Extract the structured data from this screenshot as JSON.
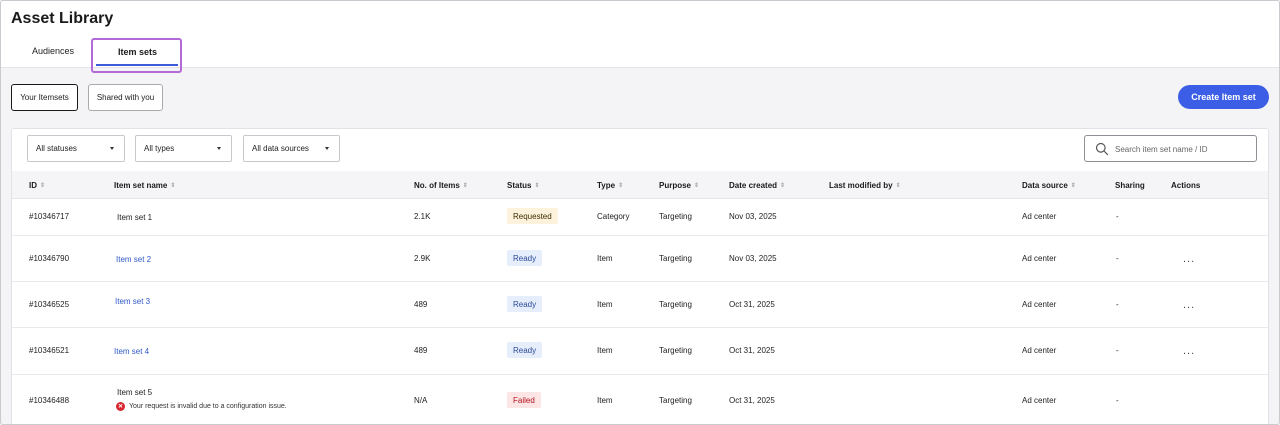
{
  "app": {
    "title": "Asset Library"
  },
  "tabs": [
    {
      "label": "Audiences"
    },
    {
      "label": "Item sets"
    }
  ],
  "segments": [
    {
      "label": "Your Itemsets"
    },
    {
      "label": "Shared with you"
    }
  ],
  "create_button": "Create Item set",
  "filters": [
    {
      "label": "All statuses"
    },
    {
      "label": "All types"
    },
    {
      "label": "All data sources"
    }
  ],
  "search": {
    "placeholder": "Search item set name / ID"
  },
  "columns": {
    "id": "ID",
    "name": "Item set name",
    "items": "No. of Items",
    "status": "Status",
    "type": "Type",
    "purpose": "Purpose",
    "created": "Date created",
    "modified": "Last modified by",
    "source": "Data source",
    "sharing": "Sharing",
    "actions": "Actions"
  },
  "rows": [
    {
      "id": "#10346717",
      "name": "Item set 1",
      "items": "2.1K",
      "status": "Requested",
      "type": "Category",
      "purpose": "Targeting",
      "created": "Nov 03, 2025",
      "source": "Ad center",
      "sharing": "-",
      "actions": ""
    },
    {
      "id": "#10346790",
      "name": "Item set 2",
      "items": "2.9K",
      "status": "Ready",
      "type": "Item",
      "purpose": "Targeting",
      "created": "Nov 03, 2025",
      "source": "Ad center",
      "sharing": "-",
      "actions": "..."
    },
    {
      "id": "#10346525",
      "name": "Item set 3",
      "items": "489",
      "status": "Ready",
      "type": "Item",
      "purpose": "Targeting",
      "created": "Oct 31, 2025",
      "source": "Ad center",
      "sharing": "-",
      "actions": "..."
    },
    {
      "id": "#10346521",
      "name": "Item set 4",
      "items": "489",
      "status": "Ready",
      "type": "Item",
      "purpose": "Targeting",
      "created": "Oct 31, 2025",
      "source": "Ad center",
      "sharing": "-",
      "actions": "..."
    },
    {
      "id": "#10346488",
      "name": "Item set 5",
      "error": "Your request is invalid due to a configuration issue.",
      "items": "N/A",
      "status": "Failed",
      "type": "Item",
      "purpose": "Targeting",
      "created": "Oct 31, 2025",
      "source": "Ad center",
      "sharing": "-",
      "actions": ""
    }
  ],
  "colors": {
    "accent": "#3c5ee6",
    "tab_highlight": "#b36ad9",
    "link": "#2e58c7",
    "requested_bg": "#fdf3dc",
    "ready_bg": "#e7eefb",
    "failed_bg": "#fde5e6",
    "failed_text": "#b3121b"
  }
}
